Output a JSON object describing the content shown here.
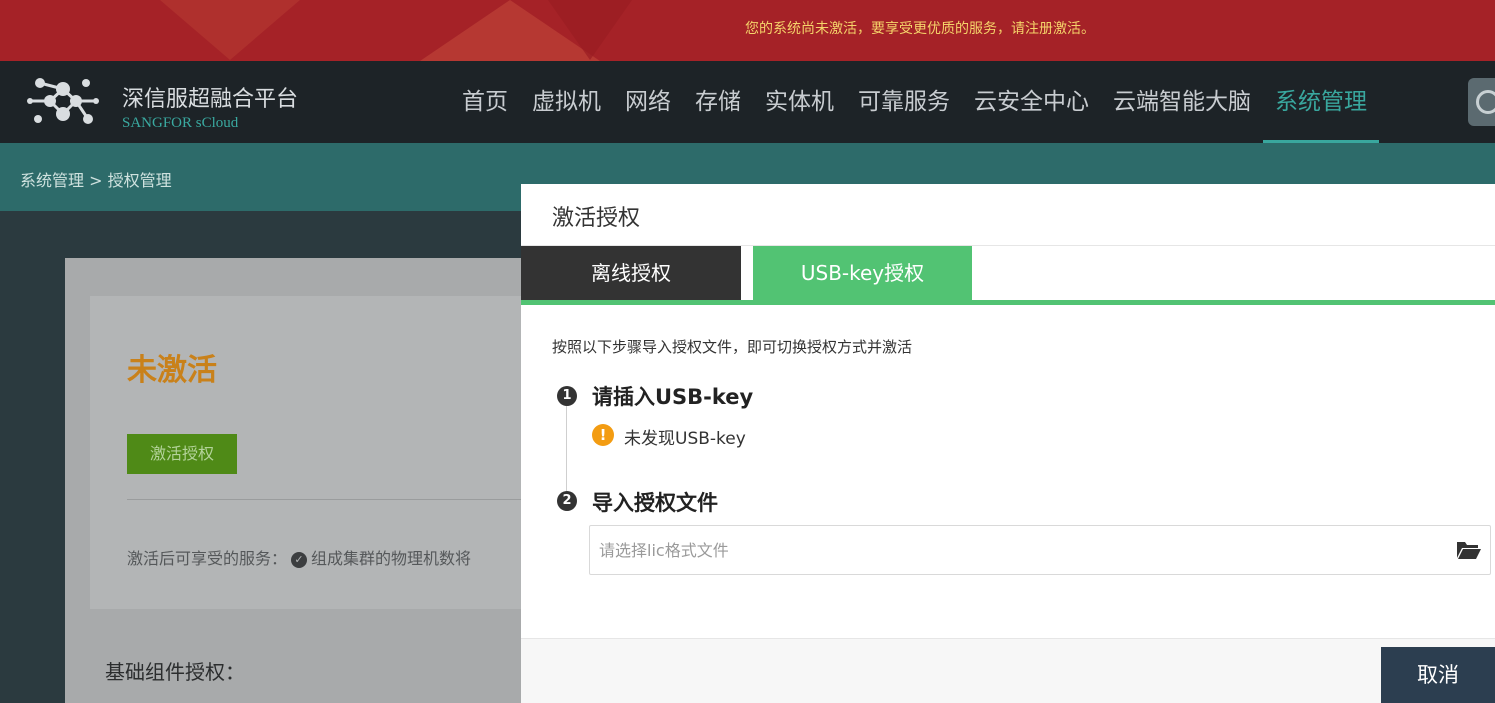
{
  "banner": {
    "message": "您的系统尚未激活，要享受更优质的服务，请注册激活。"
  },
  "brand": {
    "name_cn": "深信服超融合平台",
    "name_en": "SANGFOR sCloud"
  },
  "menu": {
    "items": [
      {
        "label": "首页"
      },
      {
        "label": "虚拟机"
      },
      {
        "label": "网络"
      },
      {
        "label": "存储"
      },
      {
        "label": "实体机"
      },
      {
        "label": "可靠服务"
      },
      {
        "label": "云安全中心"
      },
      {
        "label": "云端智能大脑"
      },
      {
        "label": "系统管理",
        "active": true
      }
    ]
  },
  "breadcrumb": {
    "text": "系统管理 > 授权管理"
  },
  "page": {
    "status": "未激活",
    "activate_button": "激活授权",
    "services_label": "激活后可享受的服务：",
    "services_item": "组成集群的物理机数将",
    "basic_label": "基础组件授权："
  },
  "dialog": {
    "title": "激活授权",
    "tabs": [
      {
        "label": "离线授权",
        "active": false
      },
      {
        "label": "USB-key授权",
        "active": true
      }
    ],
    "instruction": "按照以下步骤导入授权文件，即可切换授权方式并激活",
    "steps": [
      {
        "number": "1",
        "title": "请插入USB-key"
      },
      {
        "number": "2",
        "title": "导入授权文件"
      }
    ],
    "warning": "未发现USB-key",
    "file_input": {
      "value": "",
      "placeholder": "请选择lic格式文件"
    },
    "cancel_button": "取消"
  },
  "colors": {
    "banner": "#a52227",
    "banner_text": "#f5d36a",
    "nav": "#1d2327",
    "accent": "#39a79e",
    "tab_active": "#52c373",
    "status": "#c9811a",
    "warning": "#f39c12"
  }
}
